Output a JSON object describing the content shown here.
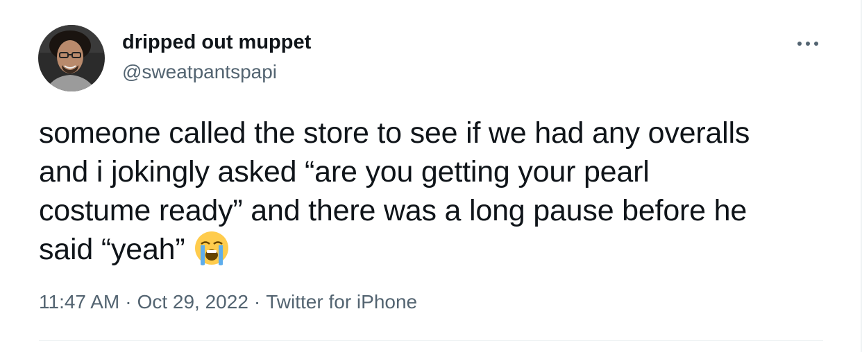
{
  "tweet": {
    "author": {
      "display_name": "dripped out muppet",
      "handle": "@sweatpantspapi",
      "avatar_icon": "profile-photo"
    },
    "more_icon": "ellipsis-icon",
    "text_lines": [
      "someone called the store to see if we had any overalls",
      "and i jokingly asked “are you getting your pearl",
      "costume ready” and there was a long pause before he",
      "said “yeah”"
    ],
    "emoji_name": "loudly-crying-face-icon",
    "time": "11:47 AM",
    "date": "Oct 29, 2022",
    "separator": "·",
    "source": "Twitter for iPhone"
  },
  "colors": {
    "text_primary": "#0f1419",
    "text_secondary": "#536471",
    "divider": "#eff3f4"
  }
}
